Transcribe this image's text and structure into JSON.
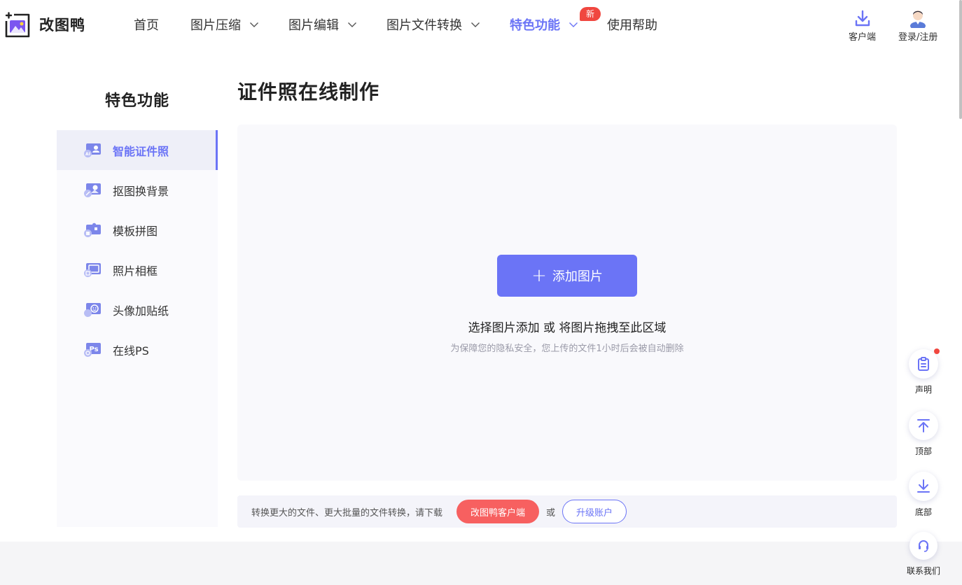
{
  "header": {
    "brand": "改图鸭",
    "nav": [
      {
        "label": "首页",
        "has_dropdown": false
      },
      {
        "label": "图片压缩",
        "has_dropdown": true
      },
      {
        "label": "图片编辑",
        "has_dropdown": true
      },
      {
        "label": "图片文件转换",
        "has_dropdown": true
      },
      {
        "label": "特色功能",
        "has_dropdown": true,
        "active": true,
        "badge": "新"
      },
      {
        "label": "使用帮助",
        "has_dropdown": false
      }
    ],
    "client_label": "客户端",
    "login_label": "登录/注册"
  },
  "sidebar": {
    "title": "特色功能",
    "items": [
      {
        "label": "智能证件照",
        "icon": "id-photo-icon",
        "active": true
      },
      {
        "label": "抠图换背景",
        "icon": "cutout-background-icon"
      },
      {
        "label": "模板拼图",
        "icon": "template-puzzle-icon"
      },
      {
        "label": "照片相框",
        "icon": "photo-frame-icon"
      },
      {
        "label": "头像加贴纸",
        "icon": "avatar-sticker-icon"
      },
      {
        "label": "在线PS",
        "icon": "online-ps-icon"
      }
    ]
  },
  "main": {
    "title": "证件照在线制作",
    "add_button": "添加图片",
    "hint": "选择图片添加 或 将图片拖拽至此区域",
    "privacy_note": "为保障您的隐私安全，您上传的文件1小时后会被自动删除"
  },
  "footer_bar": {
    "text": "转换更大的文件、更大批量的文件转换，请下载",
    "client_button": "改图鸭客户端",
    "or": "或",
    "upgrade_button": "升级账户"
  },
  "float_tools": [
    {
      "label": "声明",
      "icon": "clipboard-icon",
      "has_dot": true
    },
    {
      "label": "顶部",
      "icon": "arrow-up-icon"
    },
    {
      "label": "底部",
      "icon": "arrow-down-icon"
    },
    {
      "label": "联系我们",
      "icon": "headset-icon"
    }
  ],
  "colors": {
    "accent": "#6b74f6",
    "badge_red": "#f0473f",
    "client_red": "#f76060",
    "upload_bg": "#f9f9fc"
  }
}
